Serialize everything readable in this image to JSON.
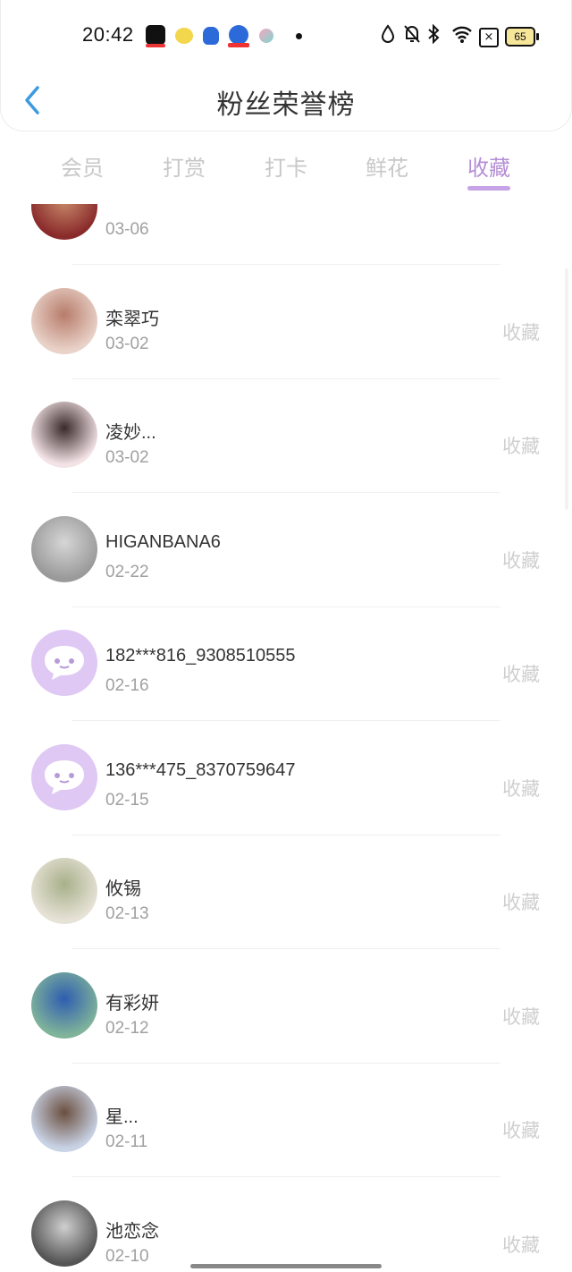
{
  "status_bar": {
    "time": "20:42",
    "battery": "65",
    "sim_icon_text": "×",
    "icons": [
      "capcut-icon",
      "emoji-app-icon",
      "baidu-icon",
      "baidu-map-icon",
      "ball-app-icon",
      "dot-icon",
      "water-drop-icon",
      "bell-muted-icon",
      "bluetooth-icon",
      "wifi-icon",
      "sim-off-icon",
      "battery-icon"
    ]
  },
  "header": {
    "title": "粉丝荣誉榜"
  },
  "tabs": [
    {
      "label": "会员",
      "active": false
    },
    {
      "label": "打赏",
      "active": false
    },
    {
      "label": "打卡",
      "active": false
    },
    {
      "label": "鲜花",
      "active": false
    },
    {
      "label": "收藏",
      "active": true
    }
  ],
  "accent_color": "#b58ed6",
  "list": {
    "items": [
      {
        "name": "",
        "date": "03-06",
        "action": "",
        "avatar": "photo"
      },
      {
        "name": "栾翠巧",
        "date": "03-02",
        "action": "收藏",
        "avatar": "photo"
      },
      {
        "name": "凌妙...",
        "date": "03-02",
        "action": "收藏",
        "avatar": "photo"
      },
      {
        "name": "HIGANBANA6",
        "date": "02-22",
        "action": "收藏",
        "avatar": "photo"
      },
      {
        "name": "182***816_9308510555",
        "date": "02-16",
        "action": "收藏",
        "avatar": "default"
      },
      {
        "name": "136***475_8370759647",
        "date": "02-15",
        "action": "收藏",
        "avatar": "default"
      },
      {
        "name": "攸锡",
        "date": "02-13",
        "action": "收藏",
        "avatar": "photo"
      },
      {
        "name": "有彩妍",
        "date": "02-12",
        "action": "收藏",
        "avatar": "photo"
      },
      {
        "name": "星...",
        "date": "02-11",
        "action": "收藏",
        "avatar": "photo"
      },
      {
        "name": "池恋念",
        "date": "02-10",
        "action": "收藏",
        "avatar": "photo"
      }
    ]
  }
}
